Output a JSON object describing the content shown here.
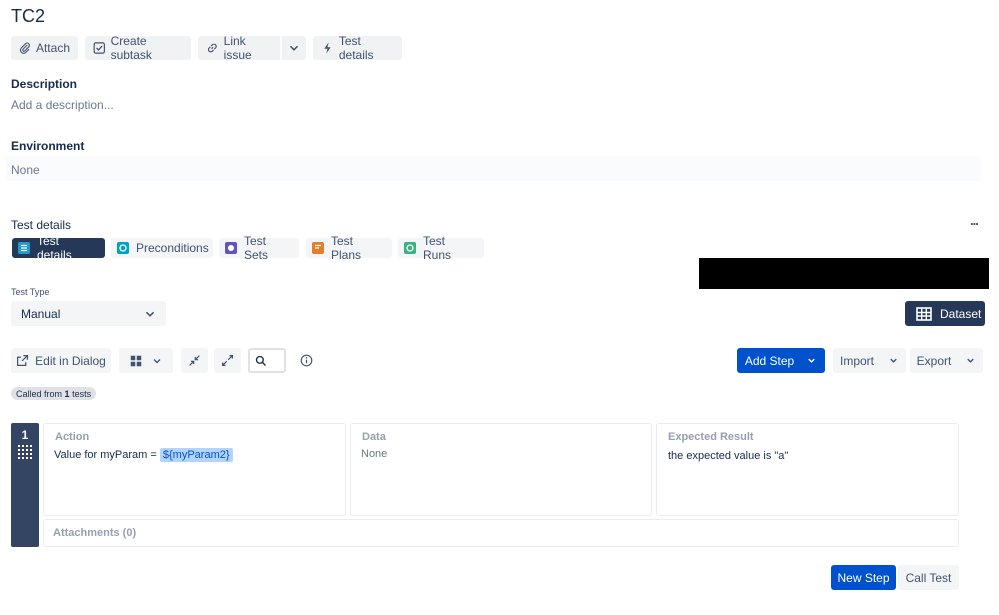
{
  "issue": {
    "title": "TC2"
  },
  "toolbar": {
    "attach": "Attach",
    "create_subtask": "Create subtask",
    "link_issue": "Link issue",
    "test_details": "Test details"
  },
  "description": {
    "label": "Description",
    "placeholder": "Add a description..."
  },
  "environment": {
    "label": "Environment",
    "value": "None"
  },
  "test_details_section": {
    "label": "Test details",
    "more": "...",
    "tabs": [
      {
        "label": "Test details",
        "icon": "list-icon",
        "color": "#1d9bd1"
      },
      {
        "label": "Preconditions",
        "icon": "precondition-icon",
        "color": "#00a3bf"
      },
      {
        "label": "Test Sets",
        "icon": "test-sets-icon",
        "color": "#6554c0"
      },
      {
        "label": "Test Plans",
        "icon": "test-plans-icon",
        "color": "#e0802c"
      },
      {
        "label": "Test Runs",
        "icon": "test-runs-icon",
        "color": "#36b37e"
      }
    ]
  },
  "test_type": {
    "label": "Test Type",
    "value": "Manual"
  },
  "dataset": {
    "label": "Dataset"
  },
  "steps_toolbar": {
    "edit_in_dialog": "Edit in Dialog",
    "add_step": "Add Step",
    "import": "Import",
    "export": "Export"
  },
  "called_from": {
    "prefix": "Called from",
    "count": "1",
    "suffix": "tests"
  },
  "steps": [
    {
      "number": "1",
      "action_header": "Action",
      "action_text": "Value for myParam =",
      "action_param": "${myParam2}",
      "data_header": "Data",
      "data_value": "None",
      "expected_header": "Expected Result",
      "expected_value": "the expected value is \"a\"",
      "attachments": "Attachments (0)"
    }
  ],
  "footer": {
    "new_step": "New Step",
    "call_test": "Call Test"
  },
  "colors": {
    "primary": "#0052cc",
    "dark": "#253858",
    "step_handle": "#344563"
  }
}
